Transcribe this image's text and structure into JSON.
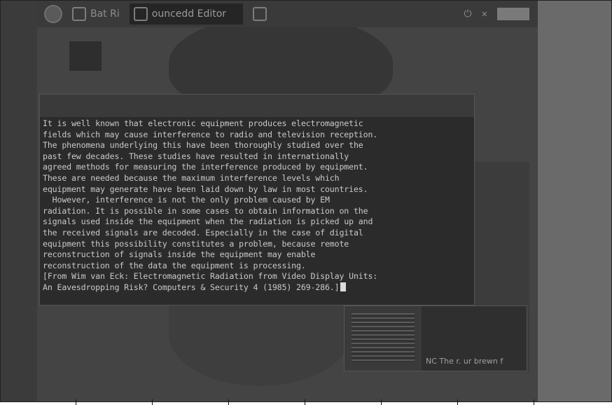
{
  "taskbar": {
    "items": [
      {
        "label": "Bat Ri",
        "icon": "globe-icon"
      },
      {
        "label": "ouncedd Editor",
        "icon": "editor-icon"
      },
      {
        "label": "",
        "icon": "tools-icon"
      }
    ],
    "right_icons": [
      "power-icon",
      "close-icon"
    ]
  },
  "editor": {
    "title": "",
    "lines": [
      "It is well known that electronic equipment produces electromagnetic",
      "fields which may cause interference to radio and television reception.",
      "The phenomena underlying this have been thoroughly studied over the",
      "past few decades. These studies have resulted in internationally",
      "agreed methods for measuring the interference produced by equipment.",
      "These are needed because the maximum interference levels which",
      "equipment may generate have been laid down by law in most countries.",
      "  However, interference is not the only problem caused by EM",
      "radiation. It is possible in some cases to obtain information on the",
      "signals used inside the equipment when the radiation is picked up and",
      "the received signals are decoded. Especially in the case of digital",
      "equipment this possibility constitutes a problem, because remote",
      "reconstruction of signals inside the equipment may enable",
      "reconstruction of the data the equipment is processing.",
      "[From Wim van Eck: Electromagnetic Radiation from Video Display Units:",
      "An Eavesdropping Risk? Computers & Security 4 (1985) 269-286.]"
    ]
  },
  "background_window": {
    "status": "NC The r. ur brewn f"
  }
}
